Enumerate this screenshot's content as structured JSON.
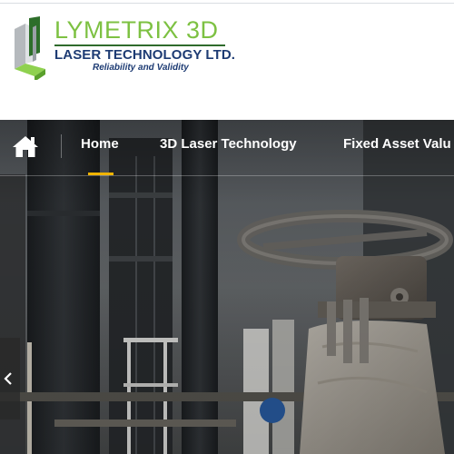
{
  "header": {
    "brand": "LYMETRIX 3D",
    "company": "LASER TECHNOLOGY LTD.",
    "tagline": "Reliability and Validity",
    "brand_color": "#7dc142",
    "company_color": "#1d3b73"
  },
  "nav": {
    "home_icon": "home-icon",
    "items": [
      {
        "label": "Home",
        "active": true
      },
      {
        "label": "3D Laser Technology",
        "active": false
      },
      {
        "label": "Fixed Asset Valu",
        "active": false
      }
    ],
    "active_color": "#f0b400"
  },
  "hero": {
    "description_icon": "chevron-left-icon"
  }
}
